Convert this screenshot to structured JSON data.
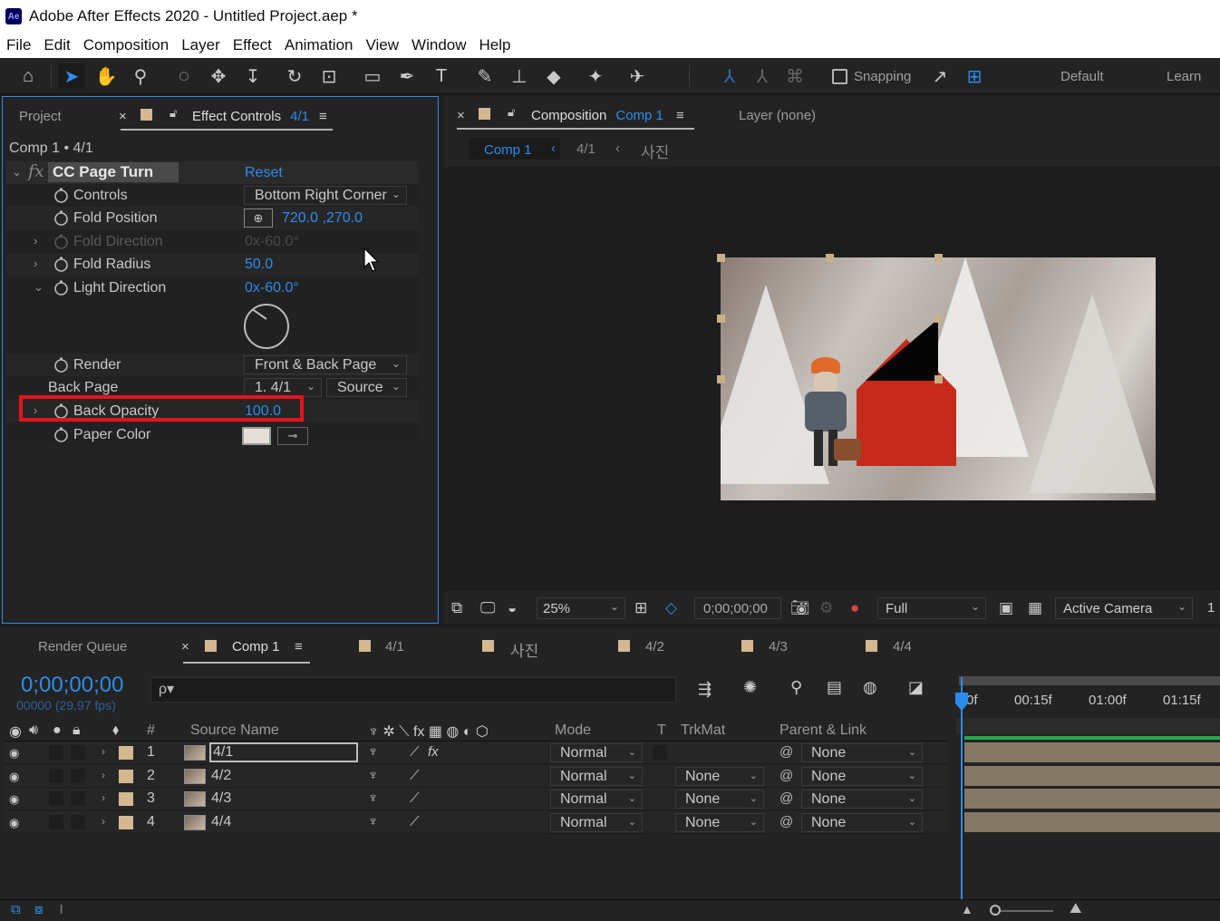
{
  "window": {
    "title": "Adobe After Effects 2020 - Untitled Project.aep *",
    "logo": "Ae"
  },
  "menu": [
    "File",
    "Edit",
    "Composition",
    "Layer",
    "Effect",
    "Animation",
    "View",
    "Window",
    "Help"
  ],
  "toolbar": {
    "snapping_label": "Snapping",
    "workspace_default": "Default",
    "workspace_learn": "Learn"
  },
  "effect_panel": {
    "tab_project": "Project",
    "tab_effect_controls": "Effect Controls",
    "tab_effect_target": "4/1",
    "comp_path": "Comp 1 • 4/1",
    "effect_name": "CC Page Turn",
    "reset_label": "Reset",
    "props": {
      "controls": {
        "label": "Controls",
        "value": "Bottom Right Corner"
      },
      "fold_position": {
        "label": "Fold Position",
        "value": "720.0 ,270.0"
      },
      "fold_direction": {
        "label": "Fold Direction",
        "value": "0x-60.0°"
      },
      "fold_radius": {
        "label": "Fold Radius",
        "value": "50.0"
      },
      "light_direction": {
        "label": "Light Direction",
        "value": "0x-60.0°"
      },
      "render": {
        "label": "Render",
        "value": "Front & Back Page"
      },
      "back_page": {
        "label": "Back Page",
        "value": "1. 4/1",
        "source": "Source"
      },
      "back_opacity": {
        "label": "Back Opacity",
        "value": "100.0"
      },
      "paper_color": {
        "label": "Paper Color",
        "color": "#e5e0d7"
      }
    }
  },
  "comp_panel": {
    "tab_composition": "Composition",
    "tab_comp_name": "Comp 1",
    "tab_layer": "Layer (none)",
    "breadcrumbs": [
      "Comp 1",
      "4/1",
      "사진"
    ],
    "viewer_bar": {
      "zoom": "25%",
      "timecode": "0;00;00;00",
      "resolution": "Full",
      "camera": "Active Camera",
      "views": "1"
    }
  },
  "timeline": {
    "tabs": [
      "Render Queue",
      "Comp 1",
      "4/1",
      "사진",
      "4/2",
      "4/3",
      "4/4"
    ],
    "timecode": "0;00;00;00",
    "fps": "00000 (29.97 fps)",
    "search_placeholder": "ρ▾",
    "columns": {
      "num": "#",
      "source_name": "Source Name",
      "mode": "Mode",
      "t": "T",
      "trkmat": "TrkMat",
      "parent": "Parent & Link"
    },
    "ruler": [
      "0f",
      "00:15f",
      "01:00f",
      "01:15f"
    ],
    "layers": [
      {
        "num": "1",
        "name": "4/1",
        "mode": "Normal",
        "trkmat": "",
        "parent": "None",
        "fx": "fx"
      },
      {
        "num": "2",
        "name": "4/2",
        "mode": "Normal",
        "trkmat": "None",
        "parent": "None",
        "fx": ""
      },
      {
        "num": "3",
        "name": "4/3",
        "mode": "Normal",
        "trkmat": "None",
        "parent": "None",
        "fx": ""
      },
      {
        "num": "4",
        "name": "4/4",
        "mode": "Normal",
        "trkmat": "None",
        "parent": "None",
        "fx": ""
      }
    ]
  },
  "colors": {
    "accent": "#2d8ceb",
    "highlight_box": "#e4141b",
    "label": "#d4b892"
  }
}
